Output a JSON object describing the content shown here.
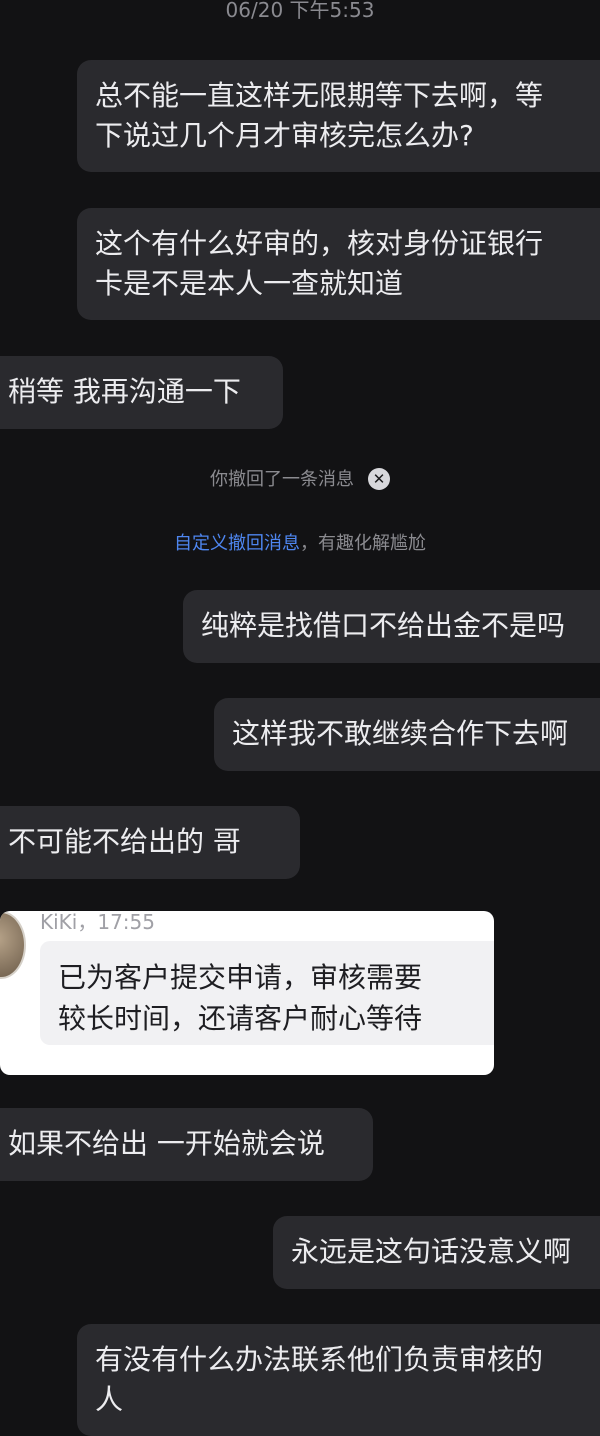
{
  "timestamp": "06/20 下午5:53",
  "messages": [
    {
      "line1": "总不能一直这样无限期等下去啊，等",
      "line2": "下说过几个月才审核完怎么办?"
    },
    {
      "line1": "这个有什么好审的，核对身份证银行",
      "line2": "卡是不是本人一查就知道"
    },
    {
      "text": "稍等  我再沟通一下"
    },
    {
      "text": "纯粹是找借口不给出金不是吗"
    },
    {
      "text": "这样我不敢继续合作下去啊"
    },
    {
      "text": "不可能不给出的  哥"
    },
    {
      "text": "如果不给出  一开始就会说"
    },
    {
      "text": "永远是这句话没意义啊"
    },
    {
      "line1": "有没有什么办法联系他们负责审核的",
      "line2": "人"
    }
  ],
  "system": {
    "recalled": "你撤回了一条消息",
    "hint_link": "自定义撤回消息",
    "hint_rest": "，有趣化解尴尬"
  },
  "quote": {
    "meta": "KiKi，17:55",
    "line1": "已为客户提交申请，审核需要",
    "line2": "较长时间，还请客户耐心等待"
  }
}
